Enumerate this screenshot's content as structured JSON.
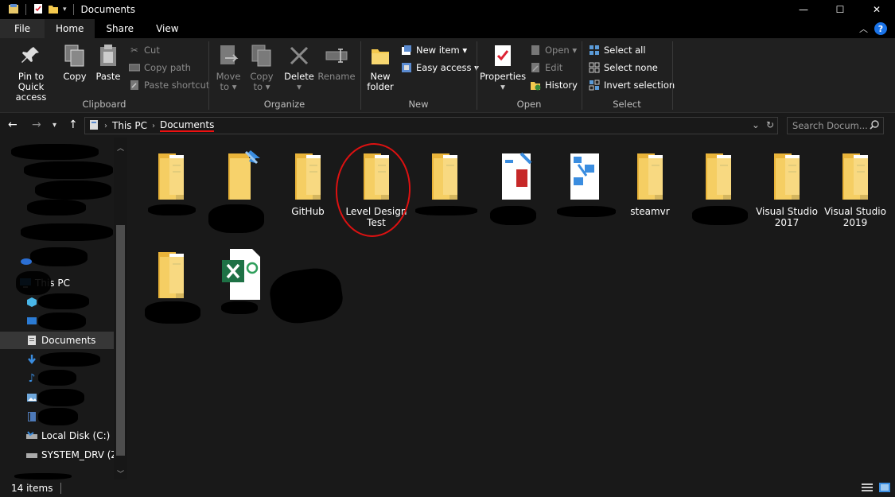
{
  "window": {
    "title": "Documents",
    "controls": {
      "minimize": "—",
      "maximize": "☐",
      "close": "✕"
    }
  },
  "ribbon_tabs": [
    "File",
    "Home",
    "Share",
    "View"
  ],
  "ribbon": {
    "clipboard": {
      "label": "Clipboard",
      "pin": [
        "Pin to Quick",
        "access"
      ],
      "copy": "Copy",
      "paste": "Paste",
      "cut": "Cut",
      "copy_path": "Copy path",
      "paste_shortcut": "Paste shortcut"
    },
    "organize": {
      "label": "Organize",
      "move_to": [
        "Move",
        "to ▾"
      ],
      "copy_to": [
        "Copy",
        "to ▾"
      ],
      "delete": [
        "Delete",
        "▾"
      ],
      "rename": "Rename"
    },
    "new": {
      "label": "New",
      "new_folder": [
        "New",
        "folder"
      ],
      "new_item": "New item ▾",
      "easy_access": "Easy access ▾"
    },
    "open": {
      "label": "Open",
      "properties": [
        "Properties",
        "▾"
      ],
      "open": "Open ▾",
      "edit": "Edit",
      "history": "History"
    },
    "select": {
      "label": "Select",
      "select_all": "Select all",
      "select_none": "Select none",
      "invert": "Invert selection"
    }
  },
  "address": {
    "breadcrumbs": [
      "This PC",
      "Documents"
    ],
    "search_placeholder": "Search Docum..."
  },
  "nav_pane": {
    "items": [
      {
        "label": "Documents",
        "selected": true
      },
      {
        "label": "Local Disk (C:)"
      },
      {
        "label": "SYSTEM_DRV (Z:)"
      },
      {
        "label": "This PC"
      }
    ]
  },
  "files": [
    {
      "name": "",
      "type": "folder"
    },
    {
      "name": "",
      "type": "folder-shortcut"
    },
    {
      "name": "GitHub",
      "type": "folder"
    },
    {
      "name": "Level Design Test",
      "type": "folder"
    },
    {
      "name": "",
      "type": "folder"
    },
    {
      "name": "",
      "type": "folder-doc"
    },
    {
      "name": "",
      "type": "folder-doc"
    },
    {
      "name": "steamvr",
      "type": "folder"
    },
    {
      "name": "",
      "type": "folder"
    },
    {
      "name": "Visual Studio 2017",
      "type": "folder"
    },
    {
      "name": "Visual Studio 2019",
      "type": "folder"
    },
    {
      "name": "",
      "type": "folder"
    },
    {
      "name": "",
      "type": "excel"
    },
    {
      "name": "",
      "type": "other"
    }
  ],
  "status": {
    "item_count": "14 items"
  },
  "colors": {
    "folder": "#f4c94e",
    "accent": "#1a73e8",
    "highlight": "#e11111"
  }
}
